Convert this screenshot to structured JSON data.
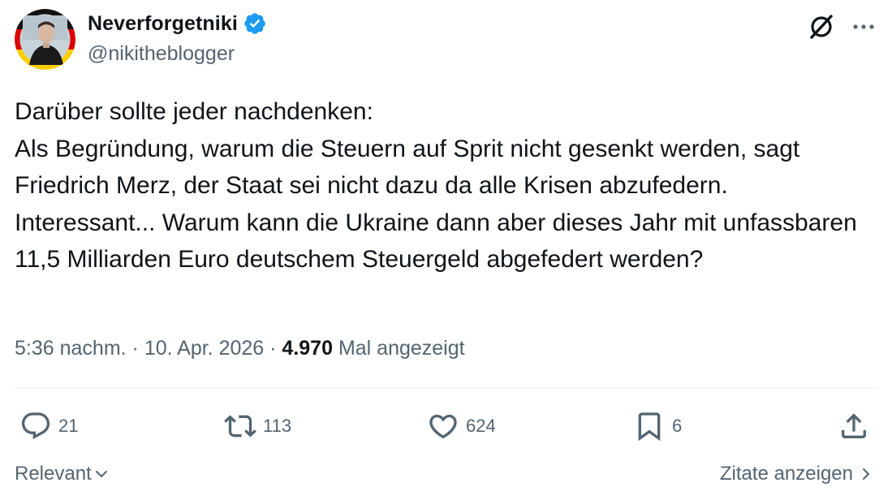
{
  "author": {
    "display_name": "Neverforgetniki",
    "handle": "@nikitheblogger",
    "verified": true,
    "avatar_icon": "profile-photo-with-german-flag-ring"
  },
  "header_icons": {
    "grok": "grok-icon",
    "more": "more-options-icon"
  },
  "tweet": {
    "text": "Darüber sollte jeder nachdenken:\nAls Begründung, warum die Steuern auf Sprit nicht gesenkt werden, sagt Friedrich Merz, der Staat sei nicht dazu da alle Krisen abzufedern.\nInteressant... Warum kann die Ukraine dann aber dieses Jahr mit unfassbaren 11,5 Milliarden Euro deutschem Steuergeld abgefedert werden?"
  },
  "meta": {
    "time": "5:36 nachm.",
    "date": "10. Apr. 2026",
    "separator": "·",
    "views_count": "4.970",
    "views_label": "Mal angezeigt"
  },
  "actions": {
    "replies": "21",
    "reposts": "113",
    "likes": "624",
    "bookmarks": "6"
  },
  "footer": {
    "sort_label": "Relevant",
    "quotes_label": "Zitate anzeigen"
  },
  "colors": {
    "text": "#0f1419",
    "secondary": "#536471",
    "verified": "#1d9bf0",
    "divider": "#eff3f4"
  }
}
